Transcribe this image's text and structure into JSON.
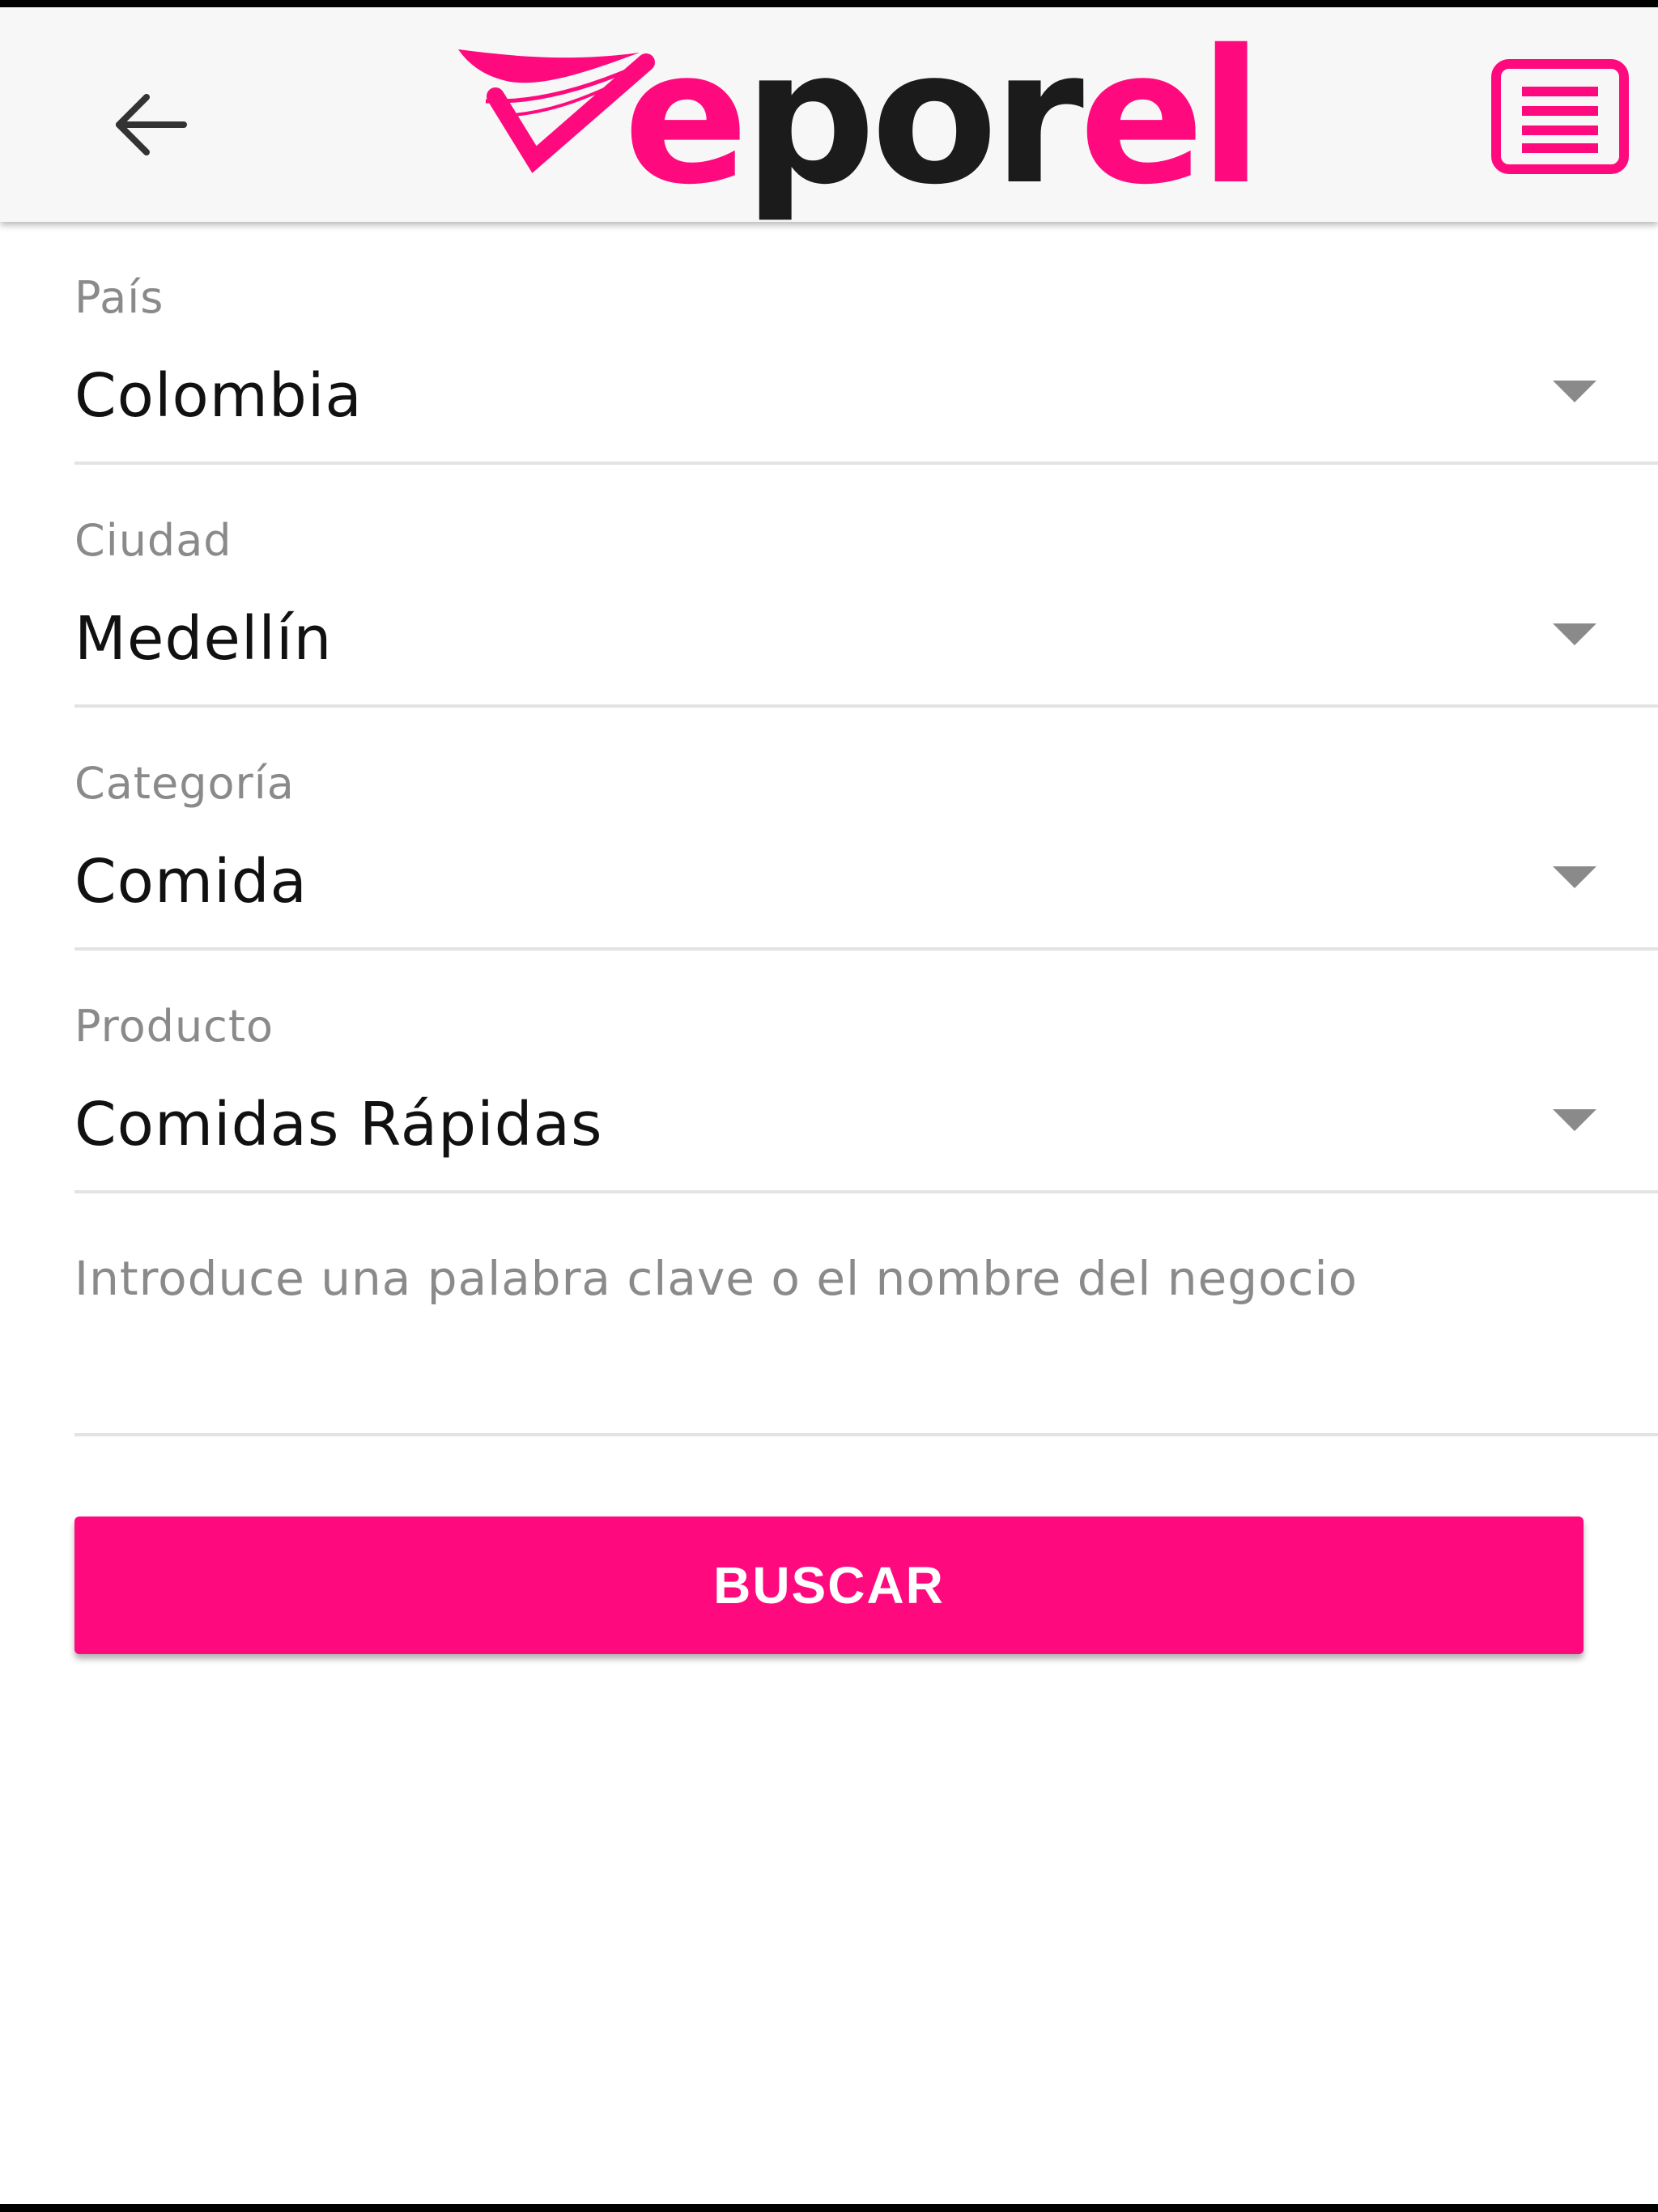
{
  "colors": {
    "brand_pink": "#ff0a7e",
    "brand_dark": "#1b1b1b",
    "header_bg": "#f7f7f7",
    "label_gray": "#8a8a8a",
    "divider": "#e3e3e3"
  },
  "header": {
    "back_icon": "arrow-left-icon",
    "logo": {
      "text_prefix": "e",
      "text_middle": "por",
      "text_suffix": "el"
    },
    "menu_icon": "menu-list-icon"
  },
  "form": {
    "fields": [
      {
        "label": "País",
        "value": "Colombia",
        "icon": "dropdown-caret-icon"
      },
      {
        "label": "Ciudad",
        "value": "Medellín",
        "icon": "dropdown-caret-icon"
      },
      {
        "label": "Categoría",
        "value": "Comida",
        "icon": "dropdown-caret-icon"
      },
      {
        "label": "Producto",
        "value": "Comidas Rápidas",
        "icon": "dropdown-caret-icon"
      }
    ],
    "keyword": {
      "placeholder": "Introduce una palabra clave o el nombre del negocio",
      "value": ""
    },
    "search_button_label": "BUSCAR"
  }
}
